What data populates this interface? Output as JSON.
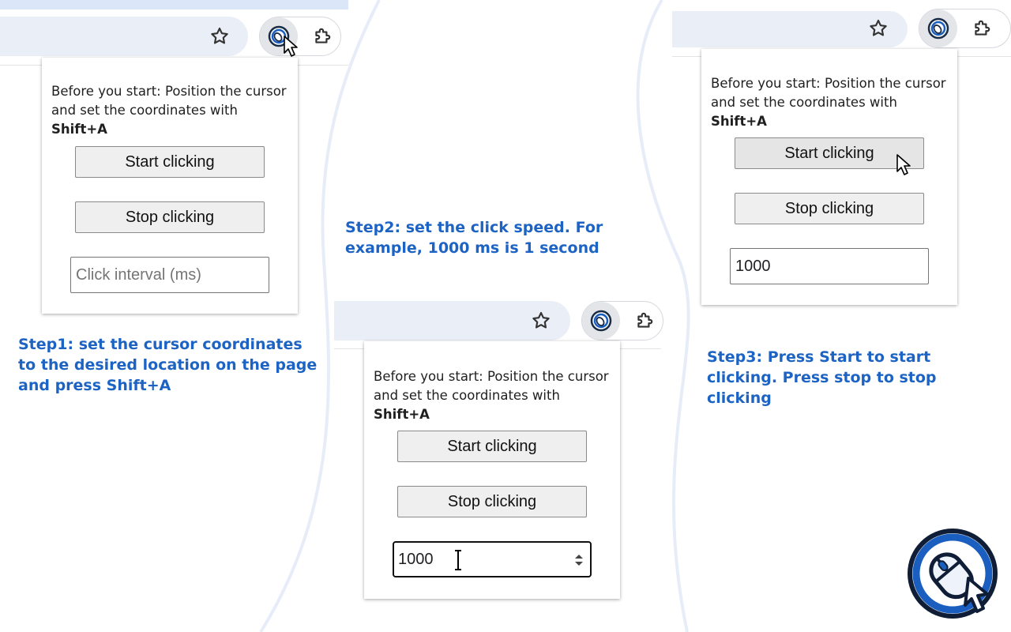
{
  "panels": [
    {
      "popup": {
        "intro_text": "Before you start: Position the cursor and set the coordinates with",
        "shortcut": "Shift+A",
        "start_label": "Start clicking",
        "stop_label": "Stop clicking",
        "interval_placeholder": "Click interval (ms)",
        "interval_value": ""
      },
      "step": {
        "prefix": "Step1:",
        "text": " set the cursor coordinates to the desired location on the page and press ",
        "shortcut": "Shift+A"
      }
    },
    {
      "popup": {
        "intro_text": "Before you start: Position the cursor and set the coordinates with",
        "shortcut": "Shift+A",
        "start_label": "Start clicking",
        "stop_label": "Stop clicking",
        "interval_value": "1000"
      },
      "step": {
        "prefix": "Step2:",
        "text": " set the click speed. For example, 1000 ms is 1 second"
      }
    },
    {
      "popup": {
        "intro_text": "Before you start: Position the cursor and set the coordinates with",
        "shortcut": "Shift+A",
        "start_label": "Start clicking",
        "stop_label": "Stop clicking",
        "interval_value": "1000"
      },
      "step": {
        "prefix": "Step3:",
        "text": " Press Start to start clicking. Press stop to stop clicking"
      }
    }
  ],
  "icons": {
    "bookmark": "star-icon",
    "extension": "auto-clicker-extension-icon",
    "extensions_menu": "puzzle-icon",
    "brand": "auto-clicker-logo"
  },
  "colors": {
    "step_text": "#1c63c4",
    "omnibox": "#eaeef7",
    "logo_blue": "#1a5fc0"
  }
}
